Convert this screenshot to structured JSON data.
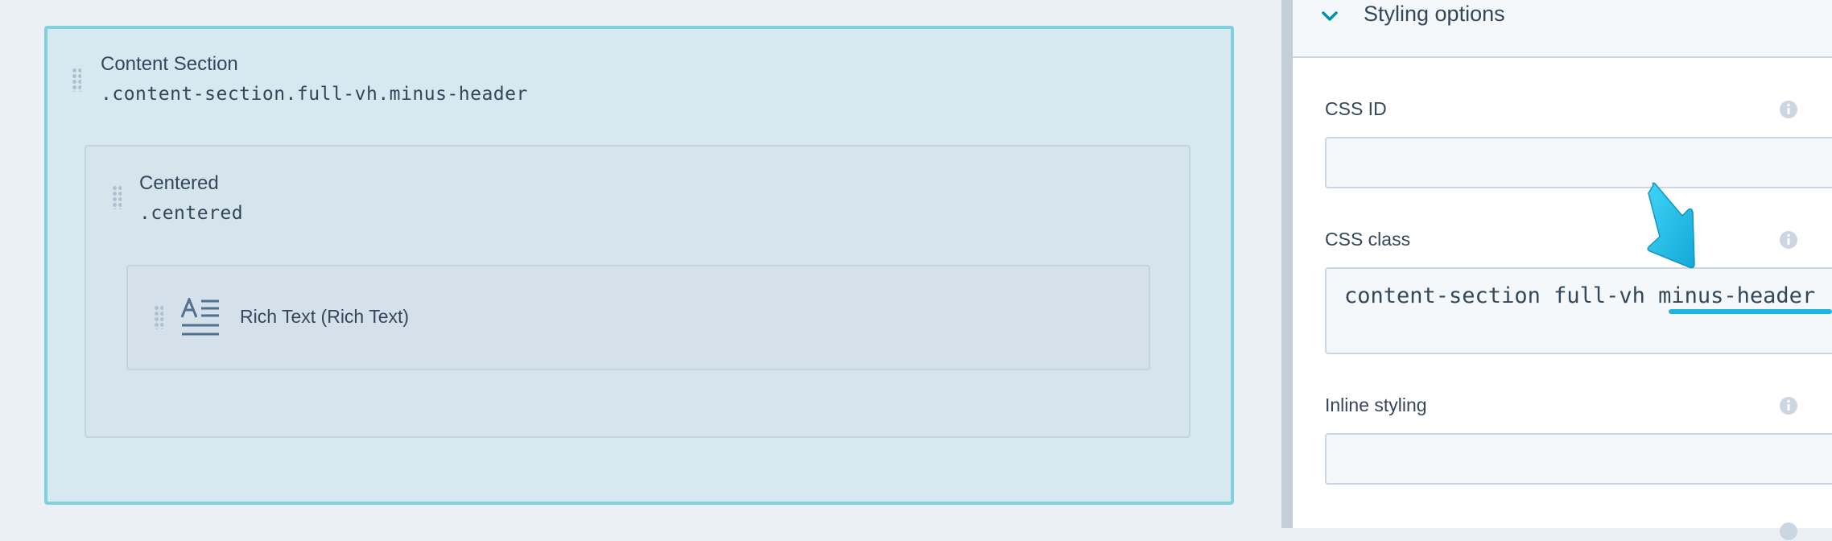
{
  "canvas": {
    "content_section": {
      "title": "Content Section",
      "classes": ".content-section.full-vh.minus-header"
    },
    "centered": {
      "title": "Centered",
      "classes": ".centered"
    },
    "rich_text": {
      "label": "Rich Text (Rich Text)",
      "icon": "rich-text-icon"
    }
  },
  "panel": {
    "header": {
      "title": "Styling options",
      "icon": "chevron-down-icon"
    },
    "fields": {
      "css_id": {
        "label": "CSS ID",
        "value": ""
      },
      "css_class": {
        "label": "CSS class",
        "value": "content-section full-vh minus-header"
      },
      "inline_styling": {
        "label": "Inline styling",
        "value": ""
      }
    },
    "info_icon": "info-icon"
  },
  "colors": {
    "accent": "#1cb4e3",
    "section_border": "#7fd1de",
    "text": "#33475b",
    "canvas_bg": "#eaf0f6"
  }
}
